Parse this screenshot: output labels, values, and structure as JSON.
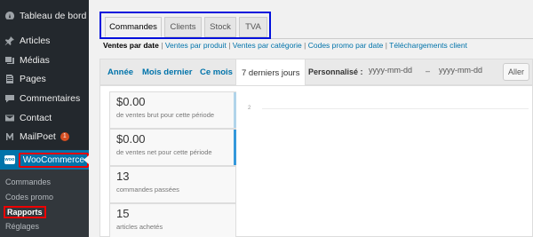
{
  "sidebar": {
    "items": [
      {
        "label": "Tableau de bord",
        "icon": "dashboard-icon"
      },
      {
        "label": "Articles",
        "icon": "pushpin-icon"
      },
      {
        "label": "Médias",
        "icon": "media-icon"
      },
      {
        "label": "Pages",
        "icon": "pages-icon"
      },
      {
        "label": "Commentaires",
        "icon": "comments-icon"
      },
      {
        "label": "Contact",
        "icon": "envelope-icon"
      },
      {
        "label": "MailPoet",
        "icon": "mailpoet-icon",
        "badge": "1"
      }
    ],
    "woocommerce": {
      "label": "WooCommerce",
      "logo_text": "woo"
    },
    "submenu": [
      "Commandes",
      "Codes promo",
      "Rapports",
      "Réglages"
    ]
  },
  "tabs": [
    "Commandes",
    "Clients",
    "Stock",
    "TVA"
  ],
  "sublinks": {
    "current": "Ventes par date",
    "items": [
      "Ventes par produit",
      "Ventes par catégorie",
      "Codes promo par date",
      "Téléchargements client"
    ],
    "separator": "|"
  },
  "range": {
    "items": [
      "Année",
      "Mois dernier",
      "Ce mois",
      "7 derniers jours"
    ],
    "custom_label": "Personnalisé :",
    "date_from_placeholder": "yyyy-mm-dd",
    "date_to_placeholder": "yyyy-mm-dd",
    "dash": "–",
    "go_label": "Aller"
  },
  "legend": [
    {
      "value": "$0.00",
      "label": "de ventes brut pour cette période",
      "color": "#b1d4ea"
    },
    {
      "value": "$0.00",
      "label": "de ventes net pour cette période",
      "color": "#3498db"
    },
    {
      "value": "13",
      "label": "commandes passées",
      "color": ""
    },
    {
      "value": "15",
      "label": "articles achetés",
      "color": ""
    }
  ],
  "chart_data": {
    "type": "line",
    "series": [],
    "y_ticks": [
      "2"
    ]
  },
  "colors": {
    "sidebar_bg": "#23282d",
    "accent": "#0073aa",
    "highlight_box": "#0010dd",
    "red_box": "#e00000",
    "badge": "#d54e21"
  }
}
